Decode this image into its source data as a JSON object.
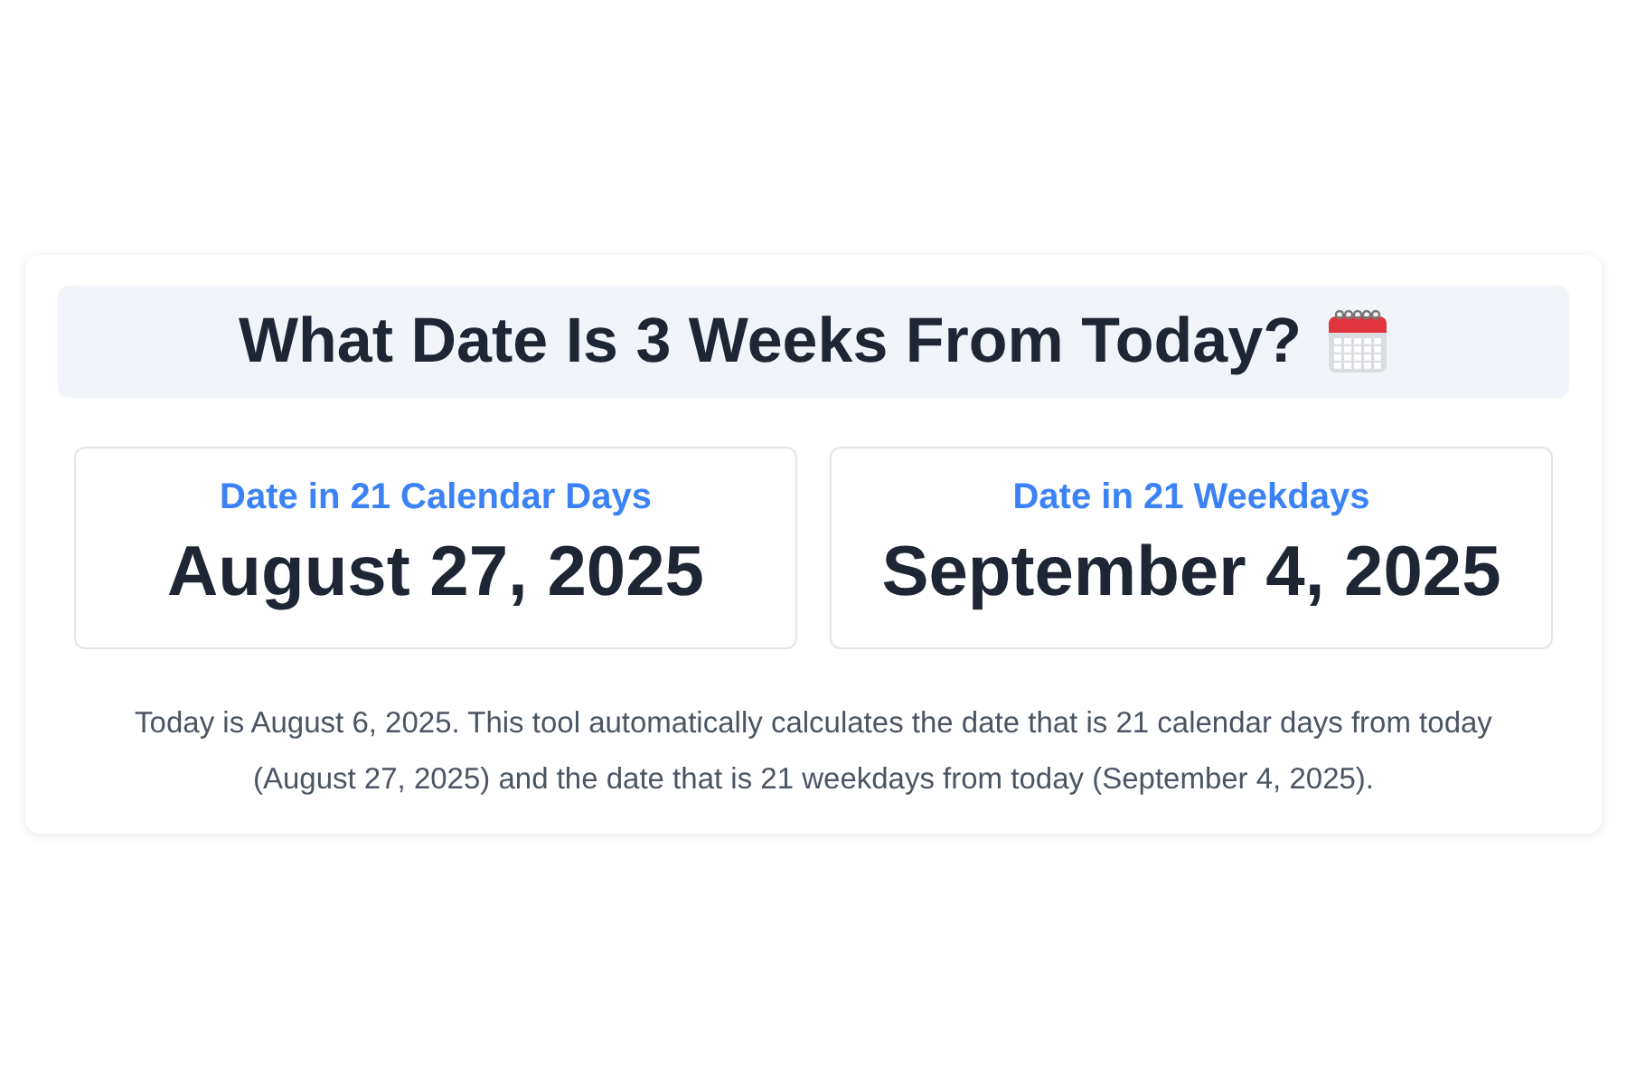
{
  "title": "What Date Is 3 Weeks From Today?",
  "results": [
    {
      "label": "Date in 21 Calendar Days",
      "date": "August 27, 2025"
    },
    {
      "label": "Date in 21 Weekdays",
      "date": "September 4, 2025"
    }
  ],
  "description": "Today is August 6, 2025. This tool automatically calculates the date that is 21 calendar days from today (August 27, 2025) and the date that is 21 weekdays from today (September 4, 2025)."
}
